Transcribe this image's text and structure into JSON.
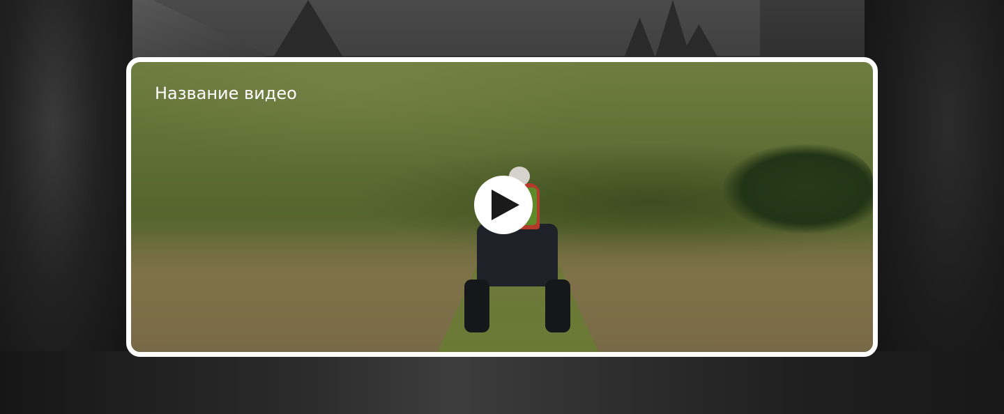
{
  "video": {
    "title": "Название видео",
    "play_icon": "play-icon"
  },
  "colors": {
    "card_border": "#ffffff",
    "play_button_bg": "#ffffff",
    "play_icon": "#1a1a1a",
    "title_text": "#ffffff"
  }
}
